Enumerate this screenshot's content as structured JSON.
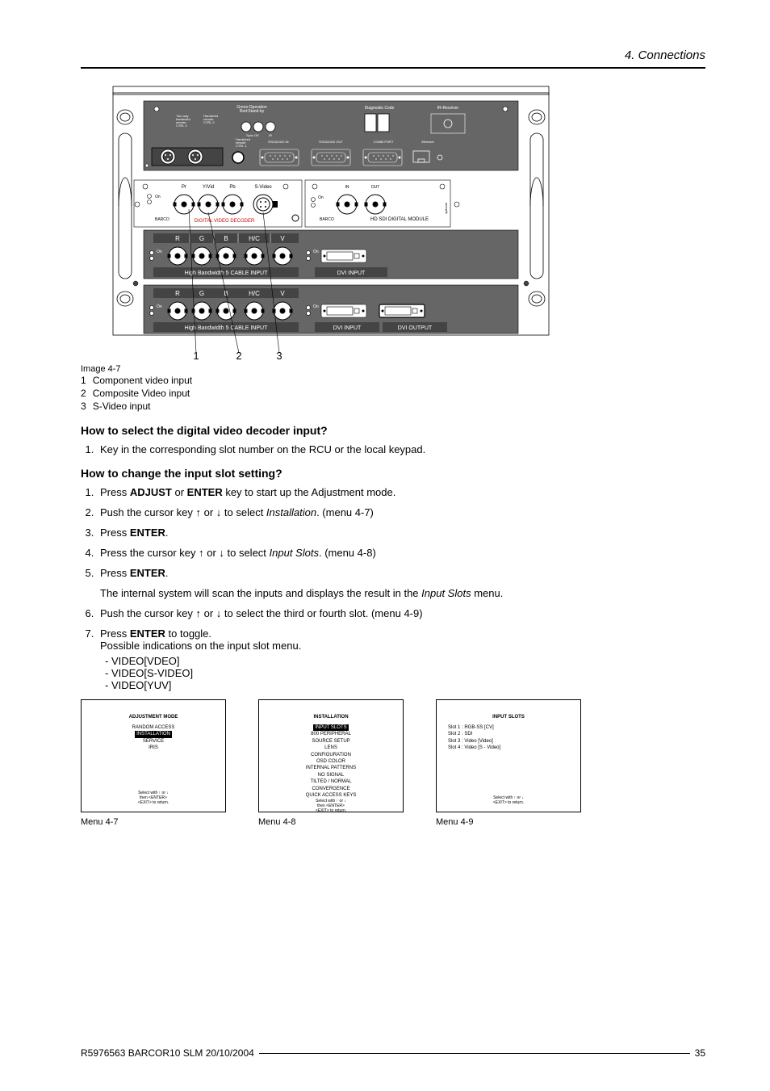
{
  "header": {
    "chapter": "4.  Connections"
  },
  "diagram": {
    "top_panel": {
      "led": "Green:Operation\nRed:Stand-by",
      "diag_code": "Diagnostic Code",
      "ir_receiver": "IR-Receiver",
      "twoway": "Two way\nhardwired\nremote\nCTRL 3",
      "hardwired2": "Hardwired\nremote\nCTRL 2",
      "hardwired1": "Hardwired\nremote\nCTRL 1",
      "sync_ok": "Sync OK",
      "ir_label": "IR",
      "rs_in": "RS232/422 IN",
      "rs_out": "RS232/422 OUT",
      "comm": "COMM PORT",
      "eth": "Ethernet"
    },
    "slot1": {
      "on": "On",
      "barco": "BARCO",
      "name": "DIGITAL VIDEO DECODER",
      "pr": "Pr",
      "yvid": "Y/Vid",
      "pb": "Pb",
      "svid": "S-Video"
    },
    "slot2": {
      "on": "On",
      "barco": "BARCO",
      "name": "HD SDI DIGITAL MODULE",
      "in": "IN",
      "out": "OUT"
    },
    "slot3": {
      "on": "On",
      "name": "High Bandwidth  5 CABLE INPUT",
      "r": "R",
      "g": "G",
      "b": "B",
      "hc": "H/C",
      "v": "V",
      "dvi_in": "DVI INPUT"
    },
    "slot4": {
      "on": "On",
      "name": "High Bandwidth  5 CABLE INPUT",
      "r": "R",
      "g": "G",
      "b": "B",
      "hc": "H/C",
      "v": "V",
      "dvi_in": "DVI INPUT",
      "dvi_out": "DVI OUTPUT"
    },
    "callouts": {
      "c1": "1",
      "c2": "2",
      "c3": "3"
    },
    "caption": "Image 4-7",
    "legend": [
      {
        "n": "1",
        "t": "Component video input"
      },
      {
        "n": "2",
        "t": "Composite Video input"
      },
      {
        "n": "3",
        "t": "S-Video input"
      }
    ]
  },
  "sectionA": {
    "title": "How to select the digital video decoder input?",
    "steps": [
      {
        "text": "Key in the corresponding slot number on the RCU or the local keypad."
      }
    ]
  },
  "sectionB": {
    "title": "How to change the input slot setting?",
    "steps": [
      {
        "pre": "Press ",
        "b1": "ADJUST",
        "mid": " or ",
        "b2": "ENTER",
        "post": " key to start up the Adjustment mode."
      },
      {
        "pre": "Push the cursor key ↑ or ↓ to select ",
        "i": "Installation",
        "post": ".  (menu 4-7)"
      },
      {
        "pre": "Press ",
        "b1": "ENTER",
        "post": "."
      },
      {
        "pre": "Press the cursor key ↑ or ↓ to select ",
        "i": "Input Slots",
        "post": ".  (menu 4-8)"
      },
      {
        "pre": "Press ",
        "b1": "ENTER",
        "post": "."
      }
    ],
    "internal_note_pre": "The internal system will scan the inputs and displays the result in the ",
    "internal_note_i": "Input Slots",
    "internal_note_post": " menu.",
    "steps2": [
      {
        "pre": "Push the cursor key ↑ or ↓ to select the third or fourth slot.  (menu 4-9)"
      },
      {
        "pre": "Press ",
        "b1": "ENTER",
        "post": " to toggle.",
        "extra": "Possible indications on the input slot menu.",
        "items": [
          "VIDEO[VDEO]",
          "VIDEO[S-VIDEO]",
          "VIDEO[YUV]"
        ]
      }
    ]
  },
  "menus": {
    "m1": {
      "title": "ADJUSTMENT MODE",
      "items": [
        "RANDOM ACCESS",
        "INSTALLATION",
        "SERVICE",
        "IRIS"
      ],
      "highlight_index": 1,
      "footer1": "Select with ↑ or ↓",
      "footer2": "then <ENTER>",
      "footer3": "<EXIT> to return.",
      "caption": "Menu 4-7"
    },
    "m2": {
      "title": "INSTALLATION",
      "items": [
        "INPUT SLOTS",
        "800 PERIPHERAL",
        "SOURCE SETUP",
        "LENS",
        "CONFIGURATION",
        "OSD COLOR",
        "INTERNAL PATTERNS",
        "NO SIGNAL",
        "TILTED / NORMAL",
        "CONVERGENCE",
        "QUICK ACCESS KEYS"
      ],
      "highlight_index": 0,
      "footer1": "Select with ↑ or ↓",
      "footer2": "then <ENTER>",
      "footer3": "<EXIT> to return.",
      "caption": "Menu 4-8"
    },
    "m3": {
      "title": "INPUT SLOTS",
      "items": [
        "Slot 1 : RGB-SS [CV]",
        "Slot 2 : SDI",
        "Slot 3 : Video [Video]",
        "Slot 4 : Video [S - Video]"
      ],
      "highlight_index": -1,
      "footer1": "Select with ↑ or ↓",
      "footer3": "<EXIT> to return.",
      "caption": "Menu 4-9"
    }
  },
  "footer": {
    "doc": "R5976563  BARCOR10 SLM  20/10/2004",
    "page": "35"
  }
}
